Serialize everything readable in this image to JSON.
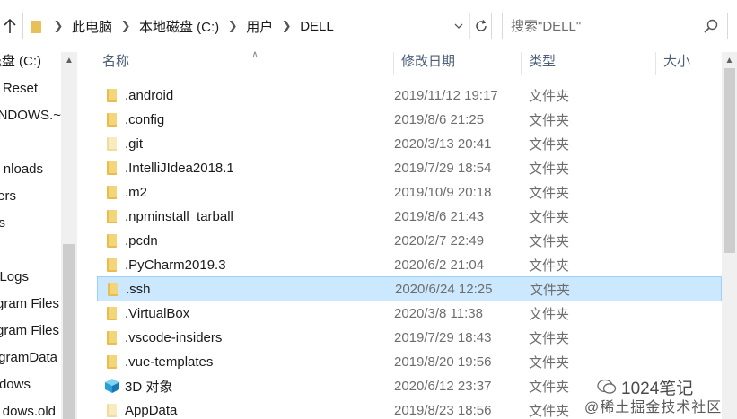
{
  "address_bar": {
    "breadcrumbs": [
      "此电脑",
      "本地磁盘 (C:)",
      "用户",
      "DELL"
    ]
  },
  "search": {
    "placeholder": "搜索\"DELL\""
  },
  "sidebar": {
    "items": [
      {
        "label": "磁盘 (C:)"
      },
      {
        "label": "Reset"
      },
      {
        "label": "NDOWS.~"
      },
      {
        "label": ""
      },
      {
        "label": "nloads"
      },
      {
        "label": "ers"
      },
      {
        "label": "s"
      },
      {
        "label": ""
      },
      {
        "label": "Logs"
      },
      {
        "label": "gram Files"
      },
      {
        "label": "gram Files"
      },
      {
        "label": "gramData"
      },
      {
        "label": "dows"
      },
      {
        "label": "dows.old"
      }
    ]
  },
  "columns": {
    "name": "名称",
    "date": "修改日期",
    "type": "类型",
    "size": "大小"
  },
  "files": [
    {
      "name": ".android",
      "date": "2019/11/12 19:17",
      "type": "文件夹",
      "icon": "folder-icon"
    },
    {
      "name": ".config",
      "date": "2019/8/6 21:25",
      "type": "文件夹",
      "icon": "folder-icon"
    },
    {
      "name": ".git",
      "date": "2020/3/13 20:41",
      "type": "文件夹",
      "icon": "folder-icon"
    },
    {
      "name": ".IntelliJIdea2018.1",
      "date": "2019/7/29 18:54",
      "type": "文件夹",
      "icon": "folder-icon"
    },
    {
      "name": ".m2",
      "date": "2019/10/9 20:18",
      "type": "文件夹",
      "icon": "folder-icon"
    },
    {
      "name": ".npminstall_tarball",
      "date": "2019/8/6 21:43",
      "type": "文件夹",
      "icon": "folder-icon"
    },
    {
      "name": ".pcdn",
      "date": "2020/2/7 22:49",
      "type": "文件夹",
      "icon": "folder-icon"
    },
    {
      "name": ".PyCharm2019.3",
      "date": "2020/6/2 21:04",
      "type": "文件夹",
      "icon": "folder-icon"
    },
    {
      "name": ".ssh",
      "date": "2020/6/24 12:25",
      "type": "文件夹",
      "icon": "folder-icon",
      "selected": true
    },
    {
      "name": ".VirtualBox",
      "date": "2020/3/8 11:38",
      "type": "文件夹",
      "icon": "folder-icon"
    },
    {
      "name": ".vscode-insiders",
      "date": "2019/7/29 18:43",
      "type": "文件夹",
      "icon": "folder-icon"
    },
    {
      "name": ".vue-templates",
      "date": "2019/8/20 19:56",
      "type": "文件夹",
      "icon": "folder-icon"
    },
    {
      "name": "3D 对象",
      "date": "2020/6/12 23:37",
      "type": "文件夹",
      "icon": "3d-objects-icon"
    },
    {
      "name": "AppData",
      "date": "2019/8/23 18:56",
      "type": "文件夹",
      "icon": "folder-icon"
    }
  ],
  "watermark": {
    "line1": "1024笔记",
    "line2": "@稀土掘金技术社区"
  },
  "colors": {
    "selection_bg": "#cce8ff",
    "selection_border": "#99d1ff",
    "folder_yellow": "#e8bd4e",
    "header_text": "#4c607a"
  }
}
